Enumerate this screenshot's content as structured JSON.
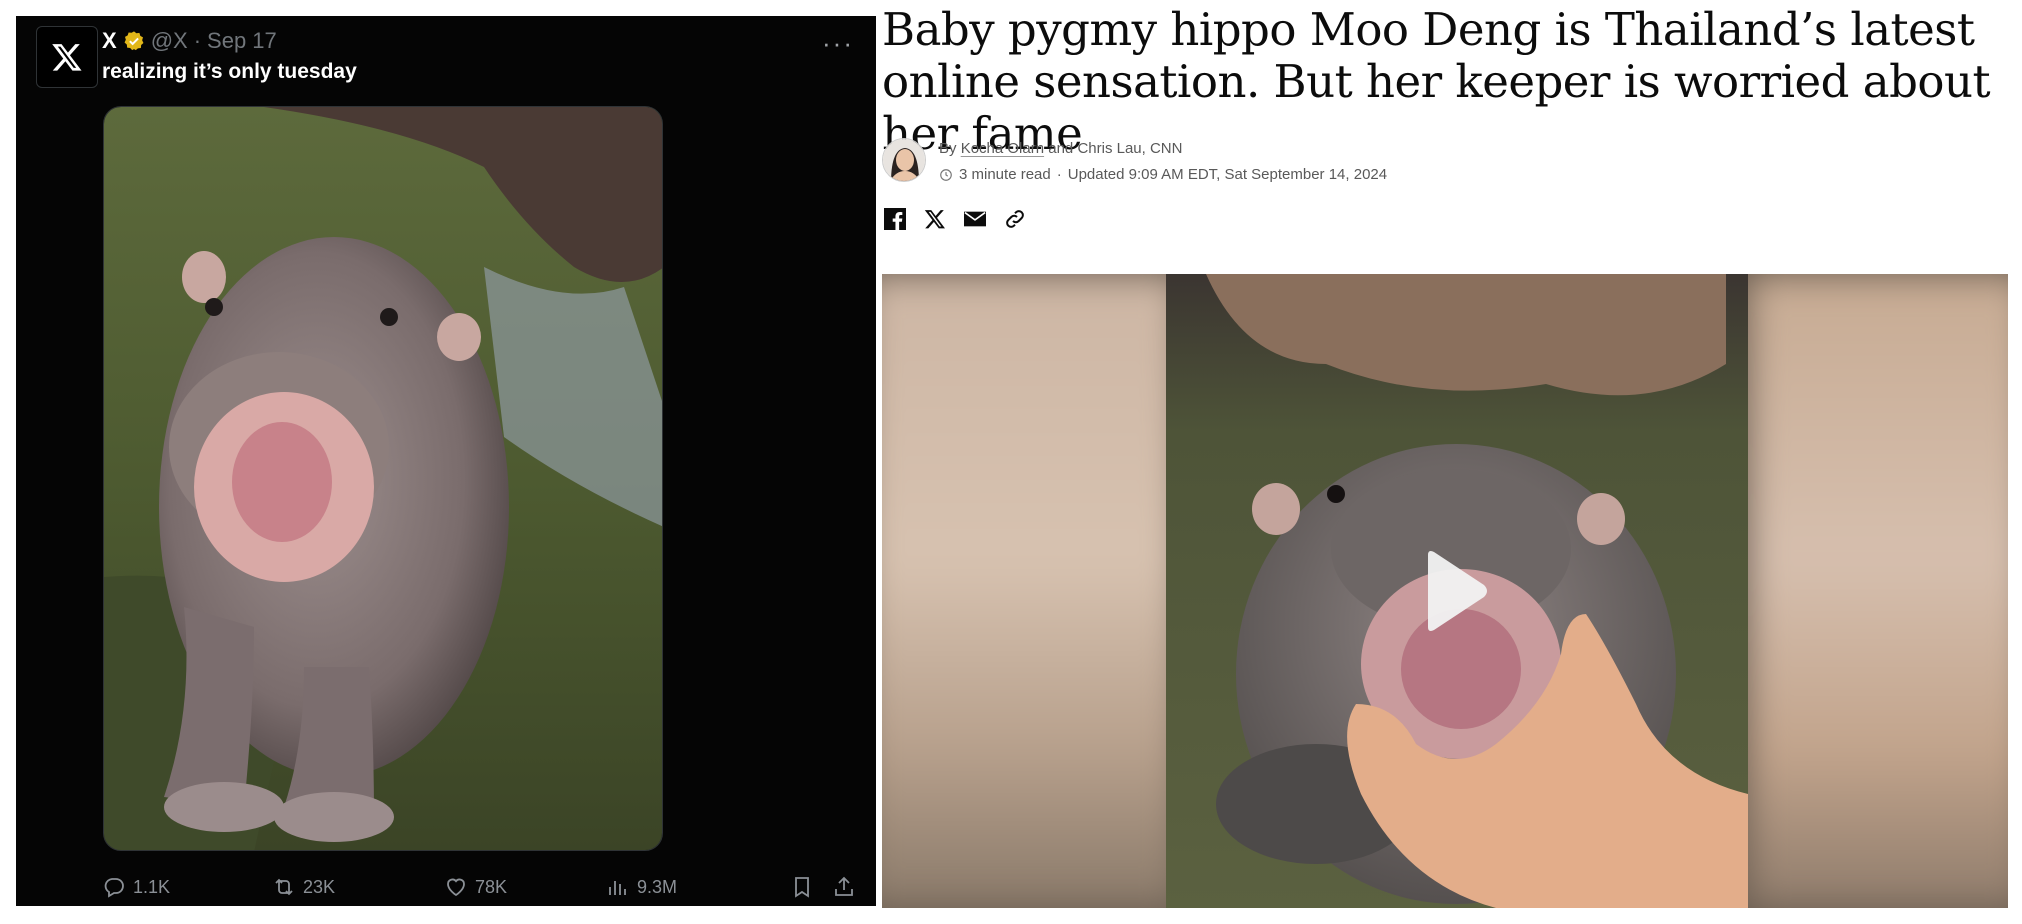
{
  "tweet": {
    "account_name": "X",
    "handle": "@X",
    "separator": "·",
    "date": "Sep 17",
    "more_label": "···",
    "text": "realizing it’s only tuesday",
    "stats": {
      "replies": "1.1K",
      "reposts": "23K",
      "likes": "78K",
      "views": "9.3M"
    },
    "icons": [
      "x-logo-icon",
      "verified-badge-icon",
      "more-icon",
      "reply-icon",
      "repost-icon",
      "like-icon",
      "views-icon",
      "bookmark-icon",
      "share-icon"
    ]
  },
  "article": {
    "headline": "Baby pygmy hippo Moo Deng is Thailand’s latest online sensation. But her keeper is worried about her fame",
    "byline_prefix": "By",
    "author_primary": "Kocha Olarn",
    "byline_rest": "and Chris Lau, CNN",
    "read_time": "3 minute read",
    "dot": "·",
    "updated": "Updated 9:09 AM EDT, Sat September 14, 2024",
    "share_icons": [
      "facebook-icon",
      "x-icon",
      "email-icon",
      "link-icon"
    ],
    "video_icon": "play-icon"
  },
  "colors": {
    "tweet_bg": "#050505",
    "tweet_text": "#e7e9ea",
    "tweet_muted": "#71767b",
    "verified_gold": "#e2b719",
    "headline_text": "#0c0c0c",
    "meta_text": "#595959"
  }
}
